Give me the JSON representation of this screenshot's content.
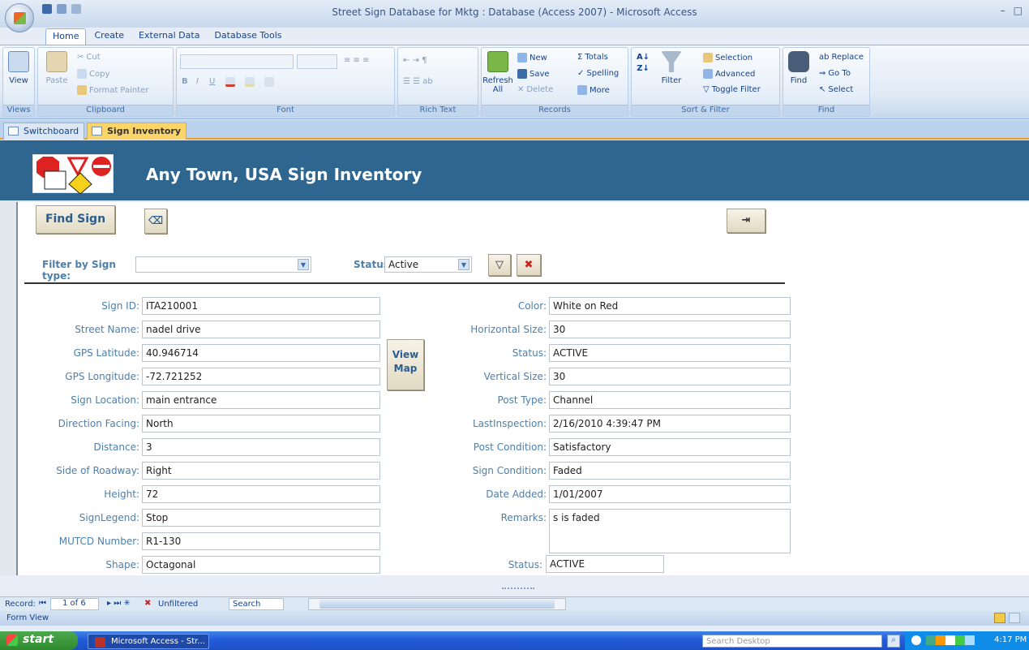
{
  "window": {
    "title": "Street Sign Database for Mktg : Database (Access 2007) - Microsoft Access",
    "controls": [
      "–",
      "□"
    ]
  },
  "ribbon_tabs": [
    "Home",
    "Create",
    "External Data",
    "Database Tools"
  ],
  "ribbon": {
    "views": {
      "view_label": "View",
      "group": "Views"
    },
    "clipboard": {
      "paste": "Paste",
      "cut": "Cut",
      "copy": "Copy",
      "format_painter": "Format Painter",
      "group": "Clipboard"
    },
    "font": {
      "bold": "B",
      "italic": "I",
      "underline": "U",
      "group": "Font"
    },
    "rich_text": {
      "group": "Rich Text"
    },
    "records": {
      "refresh": "Refresh All",
      "new": "New",
      "save": "Save",
      "delete": "Delete",
      "totals": "Totals",
      "spelling": "Spelling",
      "more": "More",
      "group": "Records"
    },
    "sort_filter": {
      "filter": "Filter",
      "selection": "Selection",
      "advanced": "Advanced",
      "toggle_filter": "Toggle Filter",
      "group": "Sort & Filter"
    },
    "find": {
      "find": "Find",
      "replace": "Replace",
      "goto": "Go To",
      "select": "Select",
      "group": "Find"
    }
  },
  "doc_tabs": [
    {
      "label": "Switchboard",
      "active": false
    },
    {
      "label": "Sign Inventory",
      "active": true
    }
  ],
  "form": {
    "title": "Any Town, USA Sign Inventory",
    "find_sign_label": "Find Sign",
    "view_map_label": "View Map",
    "filter_label": "Filter by Sign type:",
    "filter_value": "",
    "status_filter_label": "Status:",
    "status_filter_value": "Active",
    "left_fields": [
      {
        "label": "Sign ID:",
        "value": "ITA210001"
      },
      {
        "label": "Street Name:",
        "value": "nadel drive"
      },
      {
        "label": "GPS Latitude:",
        "value": "40.946714"
      },
      {
        "label": "GPS Longitude:",
        "value": "-72.721252"
      },
      {
        "label": "Sign Location:",
        "value": "main entrance"
      },
      {
        "label": "Direction Facing:",
        "value": "North"
      },
      {
        "label": "Distance:",
        "value": "3"
      },
      {
        "label": "Side of Roadway:",
        "value": "Right"
      },
      {
        "label": "Height:",
        "value": "72"
      },
      {
        "label": "SignLegend:",
        "value": "Stop"
      },
      {
        "label": "MUTCD Number:",
        "value": "R1-130"
      },
      {
        "label": "Shape:",
        "value": "Octagonal"
      }
    ],
    "right_fields": [
      {
        "label": "Color:",
        "value": "White on Red"
      },
      {
        "label": "Horizontal Size:",
        "value": "30"
      },
      {
        "label": "Status:",
        "value": "ACTIVE"
      },
      {
        "label": "Vertical Size:",
        "value": "30"
      },
      {
        "label": "Post Type:",
        "value": "Channel"
      },
      {
        "label": "LastInspection:",
        "value": "2/16/2010 4:39:47 PM"
      },
      {
        "label": "Post Condition:",
        "value": "Satisfactory"
      },
      {
        "label": "Sign Condition:",
        "value": "Faded"
      },
      {
        "label": "Date Added:",
        "value": "1/01/2007"
      },
      {
        "label": "Remarks:",
        "value": "s is faded"
      },
      {
        "label": "Status:",
        "value": "ACTIVE"
      }
    ]
  },
  "record_nav": {
    "label": "Record:",
    "position": "1 of 6",
    "filter_state": "Unfiltered",
    "search": "Search"
  },
  "status_bar": {
    "text": "Form View"
  },
  "taskbar": {
    "start": "start",
    "task": "Microsoft Access - Str...",
    "search_placeholder": "Search Desktop",
    "clock": "4:17 PM"
  }
}
